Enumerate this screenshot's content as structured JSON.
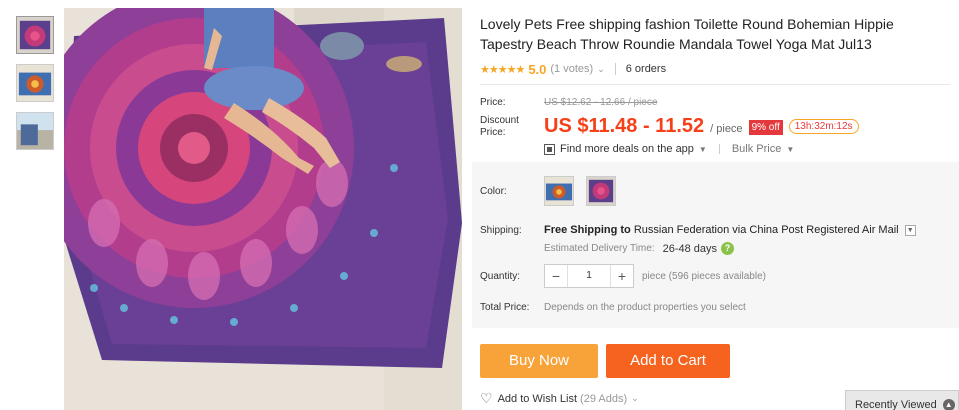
{
  "product": {
    "title": "Lovely Pets Free shipping fashion Toilette Round Bohemian Hippie Tapestry Beach Throw Roundie Mandala Towel Yoga Mat Jul13",
    "stars": "★★★★★",
    "rating": "5.0",
    "votes": "(1 votes)",
    "orders": "6 orders"
  },
  "price": {
    "price_label": "Price:",
    "original": "US $12.62 - 12.66 / piece",
    "discount_label": "Discount Price:",
    "discount": "US $11.48 - 11.52",
    "per_piece": "/ piece",
    "off": "9% off",
    "timer": "13h:32m:12s",
    "deals_app": "Find more deals on the app",
    "bulk": "Bulk Price"
  },
  "properties": {
    "color_label": "Color:",
    "shipping_label": "Shipping:",
    "shipping_free": "Free Shipping to",
    "shipping_rest": "Russian Federation via China Post Registered Air Mail",
    "est_label": "Estimated Delivery Time:",
    "est_days": "26-48 days",
    "quantity_label": "Quantity:",
    "quantity": "1",
    "minus": "−",
    "plus": "+",
    "available": "piece (596 pieces available)",
    "total_label": "Total Price:",
    "total_text": "Depends on the product properties you select"
  },
  "actions": {
    "buy_now": "Buy Now",
    "add_to_cart": "Add to Cart",
    "wish_list": "Add to Wish List",
    "wish_count": "(29 Adds)",
    "recently_viewed": "Recently Viewed"
  },
  "colors": {
    "buy": "#f7a33a",
    "cart": "#f5631e",
    "price": "#f5401a",
    "star": "#f5a623"
  }
}
